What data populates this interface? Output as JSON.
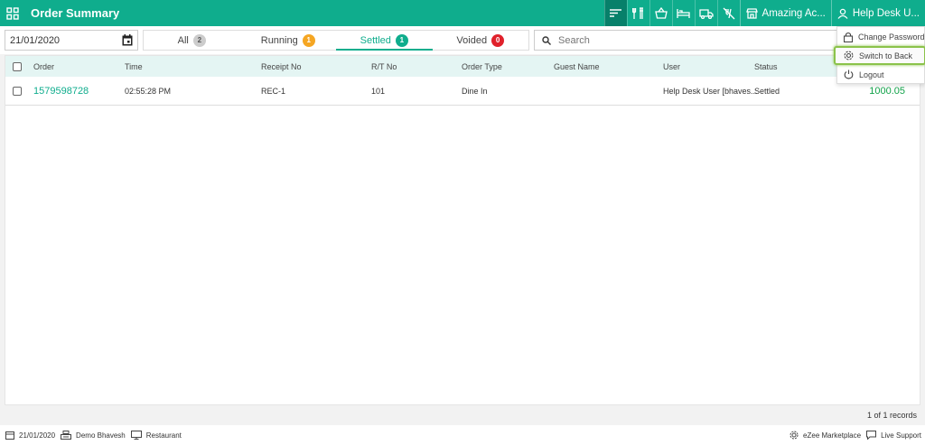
{
  "header": {
    "title": "Order Summary",
    "outlet_name": "Amazing Ac...",
    "user_name": "Help Desk U...",
    "nav_icons": [
      "sort-icon",
      "dining-icon",
      "basket-icon",
      "bed-icon",
      "delivery-truck-icon",
      "no-service-icon"
    ]
  },
  "filters": {
    "date": "21/01/2020",
    "search_placeholder": "Search",
    "tabs": [
      {
        "label": "All",
        "count": "2",
        "color": "#cccccc",
        "active": false
      },
      {
        "label": "Running",
        "count": "1",
        "color": "#f5a623",
        "active": false
      },
      {
        "label": "Settled",
        "count": "1",
        "color": "#0fad8d",
        "active": true
      },
      {
        "label": "Voided",
        "count": "0",
        "color": "#e0212b",
        "active": false
      }
    ]
  },
  "table": {
    "columns": [
      "Order",
      "Time",
      "Receipt No",
      "R/T No",
      "Order Type",
      "Guest Name",
      "User",
      "Status"
    ],
    "rows": [
      {
        "order": "1579598728",
        "time": "02:55:28 PM",
        "receipt": "REC-1",
        "rt": "101",
        "type": "Dine In",
        "guest": "",
        "user": "Help Desk User [bhaves...",
        "status": "Settled",
        "amount": "1000.05"
      }
    ],
    "records": "1 of 1 records"
  },
  "user_menu": {
    "items": [
      "Change Password",
      "Switch to Back",
      "Logout"
    ]
  },
  "footer": {
    "date": "21/01/2020",
    "user": "Demo Bhavesh",
    "mode": "Restaurant",
    "marketplace": "eZee Marketplace",
    "support": "Live Support"
  }
}
